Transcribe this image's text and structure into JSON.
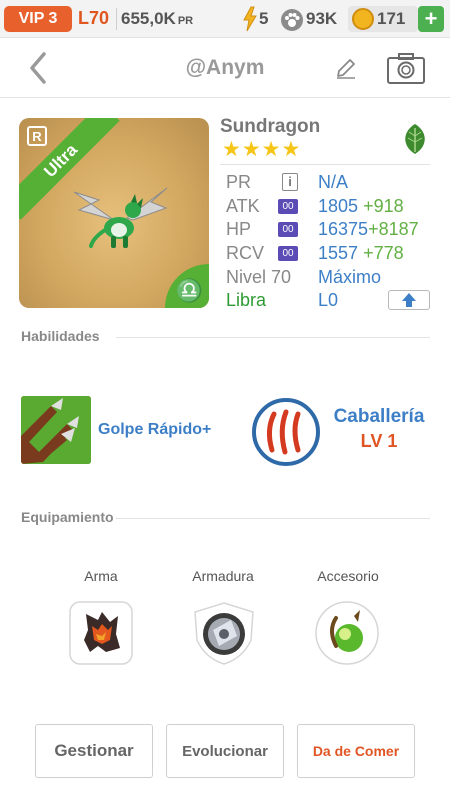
{
  "status_bar": {
    "vip": "VIP 3",
    "level": "L70",
    "power_value": "655,0K",
    "power_label": "PR",
    "energy_icon": "lightning-icon",
    "energy": "5",
    "food_icon": "paw-icon",
    "food": "93K",
    "gold_icon": "gold-coin-icon",
    "gold": "171",
    "add_label": "+"
  },
  "header": {
    "title": "@Anym",
    "back_icon": "chevron-left-icon",
    "edit_icon": "pencil-icon",
    "camera_icon": "camera-icon"
  },
  "card": {
    "rarity_letter": "R",
    "rarity_label": "Ultra",
    "zodiac_symbol": "♎",
    "element_color": "#55b035"
  },
  "character": {
    "name": "Sundragon",
    "stars": 4,
    "element_icon": "leaf-icon"
  },
  "stats": {
    "pr": {
      "label": "PR",
      "value": "N/A"
    },
    "atk": {
      "label": "ATK",
      "value": "1805",
      "bonus": "+918"
    },
    "hp": {
      "label": "HP",
      "value": "16375",
      "bonus": "+8187"
    },
    "rcv": {
      "label": "RCV",
      "value": "1557",
      "bonus": "+778"
    },
    "level": {
      "label": "Nivel 70",
      "value": "Máximo"
    },
    "sign": {
      "label": "Libra",
      "value": "L0"
    },
    "book_label": "00",
    "info_label": "i"
  },
  "sections": {
    "skills": "Habilidades",
    "equipment": "Equipamiento"
  },
  "skills": {
    "active": "Golpe Rápido+",
    "leader": "Caballería",
    "leader_level": "LV 1"
  },
  "equipment": {
    "weapon": "Arma",
    "armor": "Armadura",
    "accessory": "Accesorio"
  },
  "actions": {
    "manage": "Gestionar",
    "evolve": "Evolucionar",
    "feed": "Da de Comer"
  },
  "colors": {
    "vip": "#e8612c",
    "link_blue": "#3d7fc7",
    "bonus_green": "#62b043",
    "accent_orange": "#e05523",
    "libra_green": "#2f9b34",
    "star": "#f5c518"
  }
}
